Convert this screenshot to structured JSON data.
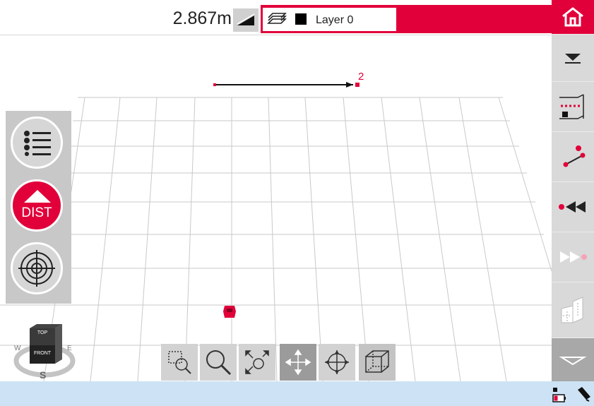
{
  "toolbar": {
    "distance_readout": "2.867m",
    "layer_name": "Layer 0",
    "icons": {
      "slope": "slope-icon",
      "layers": "layers-icon",
      "layer_color": "layer-color-swatch"
    }
  },
  "right_toolbar": {
    "items": [
      {
        "icon": "home-icon"
      },
      {
        "icon": "collapse-down-icon"
      },
      {
        "icon": "wall-measure-icon"
      },
      {
        "icon": "point-line-icon"
      },
      {
        "icon": "step-back-icon"
      },
      {
        "icon": "step-forward-icon"
      },
      {
        "icon": "floor-plan-icon"
      },
      {
        "icon": "expand-down-icon"
      }
    ]
  },
  "left_panel": {
    "items": [
      {
        "icon": "list-icon"
      },
      {
        "icon": "dist-button",
        "label": "DIST"
      },
      {
        "icon": "target-icon"
      }
    ]
  },
  "viewport": {
    "point_label": "2",
    "view_cube": {
      "top": "TOP",
      "front": "FRONT",
      "west": "W",
      "east": "E",
      "south": "S"
    }
  },
  "bottom_toolbar": {
    "items": [
      {
        "icon": "zoom-window-icon"
      },
      {
        "icon": "zoom-icon"
      },
      {
        "icon": "zoom-extents-icon"
      },
      {
        "icon": "pan-icon"
      },
      {
        "icon": "orbit-icon"
      },
      {
        "icon": "box-view-icon"
      }
    ]
  },
  "colors": {
    "accent": "#e2003a",
    "panel": "#c8c8c8",
    "status": "#cde3f5"
  }
}
